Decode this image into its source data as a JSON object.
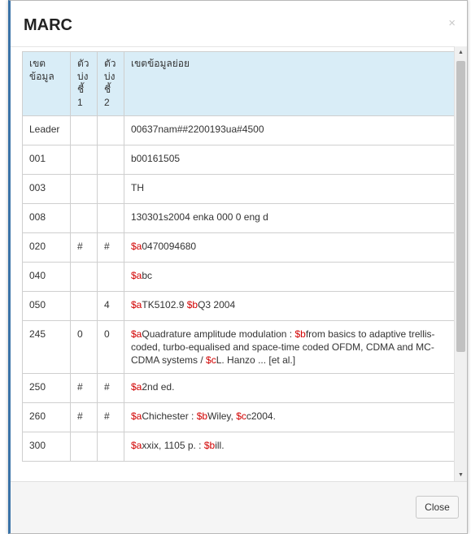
{
  "dialog": {
    "title": "MARC",
    "close_symbol": "×",
    "close_button_label": "Close"
  },
  "table": {
    "headers": [
      "เขตข้อมูล",
      "ตัวบ่งชี้ 1",
      "ตัวบ่งชี้ 2",
      "เขตข้อมูลย่อย"
    ],
    "rows": [
      {
        "tag": "Leader",
        "ind1": "",
        "ind2": "",
        "data": [
          {
            "t": "00637nam##2200193ua#4500"
          }
        ]
      },
      {
        "tag": "001",
        "ind1": "",
        "ind2": "",
        "data": [
          {
            "t": "b00161505"
          }
        ]
      },
      {
        "tag": "003",
        "ind1": "",
        "ind2": "",
        "data": [
          {
            "t": "TH"
          }
        ]
      },
      {
        "tag": "008",
        "ind1": "",
        "ind2": "",
        "data": [
          {
            "t": "130301s2004 enka 000 0 eng d"
          }
        ]
      },
      {
        "tag": "020",
        "ind1": "#",
        "ind2": "#",
        "data": [
          {
            "s": "$a"
          },
          {
            "t": "0470094680"
          }
        ]
      },
      {
        "tag": "040",
        "ind1": "",
        "ind2": "",
        "data": [
          {
            "s": "$a"
          },
          {
            "t": "bc"
          }
        ]
      },
      {
        "tag": "050",
        "ind1": "",
        "ind2": "4",
        "data": [
          {
            "s": "$a"
          },
          {
            "t": "TK5102.9 "
          },
          {
            "s": "$b"
          },
          {
            "t": "Q3 2004"
          }
        ]
      },
      {
        "tag": "245",
        "ind1": "0",
        "ind2": "0",
        "data": [
          {
            "s": "$a"
          },
          {
            "t": "Quadrature amplitude modulation : "
          },
          {
            "s": "$b"
          },
          {
            "t": "from basics to adaptive trellis-coded, turbo-equalised and space-time coded OFDM, CDMA and MC-CDMA systems / "
          },
          {
            "s": "$c"
          },
          {
            "t": "L. Hanzo ... [et al.]"
          }
        ]
      },
      {
        "tag": "250",
        "ind1": "#",
        "ind2": "#",
        "data": [
          {
            "s": "$a"
          },
          {
            "t": "2nd ed."
          }
        ]
      },
      {
        "tag": "260",
        "ind1": "#",
        "ind2": "#",
        "data": [
          {
            "s": "$a"
          },
          {
            "t": "Chichester : "
          },
          {
            "s": "$b"
          },
          {
            "t": "Wiley, "
          },
          {
            "s": "$c"
          },
          {
            "t": "c2004."
          }
        ]
      },
      {
        "tag": "300",
        "ind1": "",
        "ind2": "",
        "data": [
          {
            "s": "$a"
          },
          {
            "t": "xxix, 1105 p. : "
          },
          {
            "s": "$b"
          },
          {
            "t": "ill."
          }
        ]
      }
    ]
  },
  "icons": {
    "close": "close-x-icon",
    "scroll_up": "scroll-up-arrow-icon",
    "scroll_down": "scroll-down-arrow-icon"
  },
  "colors": {
    "subfield_code": "#d10000",
    "header_bg": "#d9edf7",
    "accent_border": "#3a73a8"
  }
}
